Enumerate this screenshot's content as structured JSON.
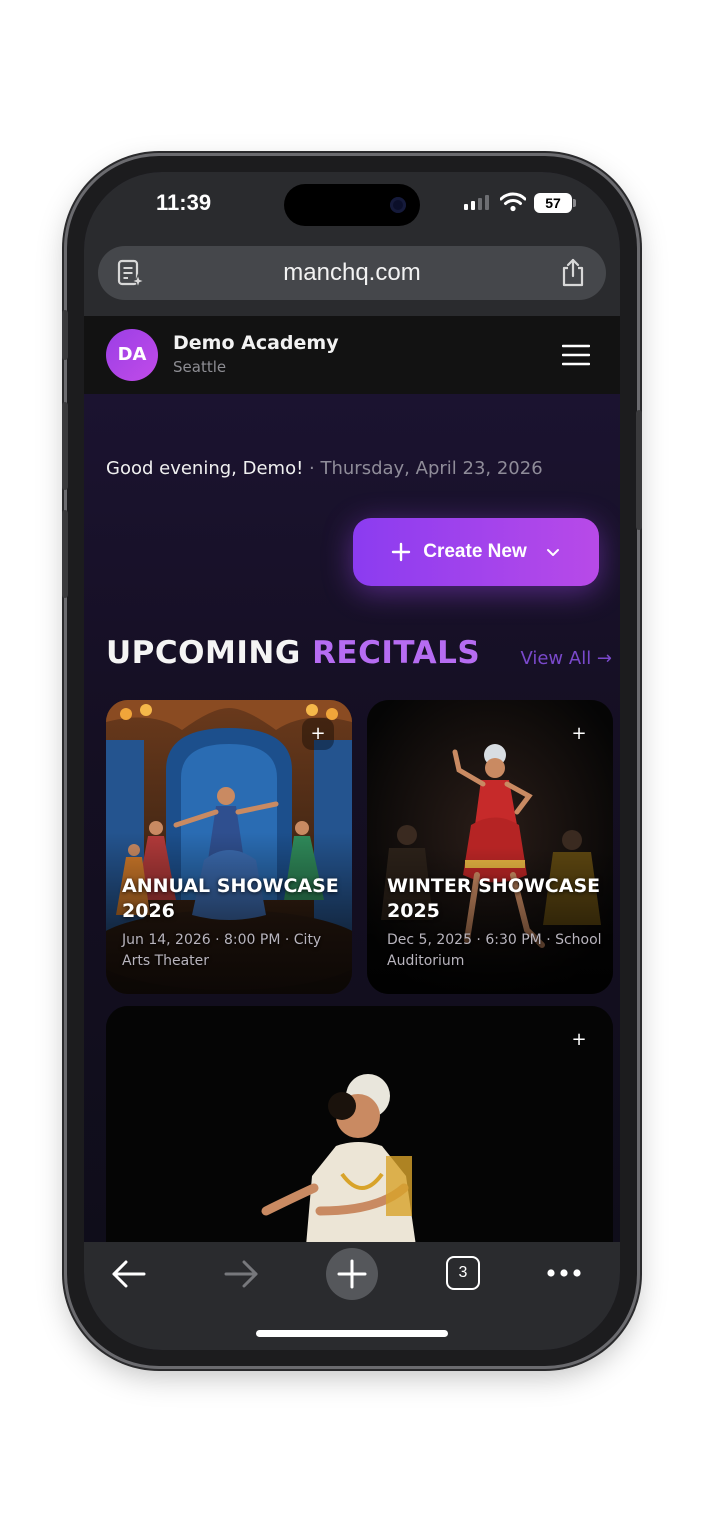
{
  "status": {
    "time": "11:39",
    "battery": "57"
  },
  "browser": {
    "url": "manchq.com",
    "tab_count": "3"
  },
  "header": {
    "avatar_initials": "DA",
    "academy_name": "Demo Academy",
    "location": "Seattle"
  },
  "main": {
    "greeting": "Good evening, Demo!",
    "separator": " · ",
    "date": "Thursday, April 23, 2026",
    "create_button": {
      "icon": "plus",
      "label": "Create New",
      "caret": "chevron-down"
    },
    "section": {
      "title_part1": "UPCOMING ",
      "title_part2": "RECITALS",
      "view_all": "View All →"
    },
    "recitals": [
      {
        "title_line1": "ANNUAL SHOWCASE",
        "title_line2": "2026",
        "meta_line1": "Jun 14, 2026 · 8:00 PM · City",
        "meta_line2": "Arts Theater",
        "add_icon": "+"
      },
      {
        "title_line1": "WINTER SHOWCASE",
        "title_line2": "2025",
        "meta_line1": "Dec 5, 2025 · 6:30 PM · School",
        "meta_line2": "Auditorium",
        "add_icon": "+"
      },
      {
        "add_icon": "+"
      }
    ]
  },
  "colors": {
    "accent": "#9b3fe6",
    "accent_light": "#b66cf2",
    "background": "#150f23",
    "chrome": "#2a2b2e"
  }
}
